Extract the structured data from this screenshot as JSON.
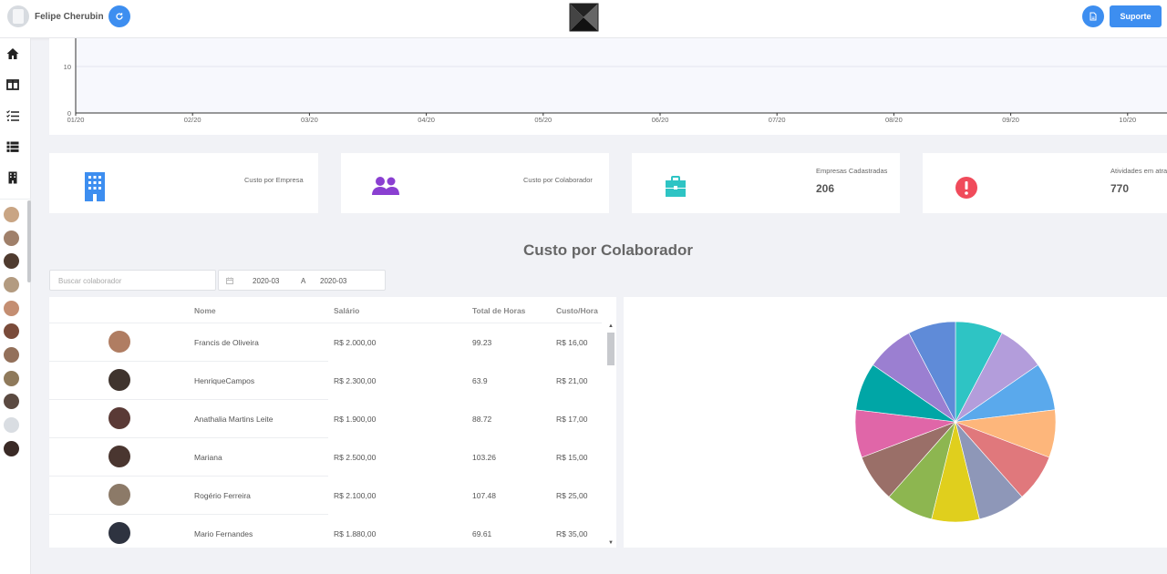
{
  "header": {
    "user_name": "Felipe Cherubin",
    "support_label": "Suporte"
  },
  "sidebar": {
    "nav": [
      "home-icon",
      "columns-icon",
      "task-list-icon",
      "list-icon",
      "building-icon"
    ],
    "avatars": [
      "#c9a584",
      "#a0806a",
      "#4f3b2f",
      "#b39b80",
      "#c48e72",
      "#7a4b3a",
      "#93705a",
      "#8f7a5b",
      "#5b4a41",
      "#d9dde2",
      "#3a2a26"
    ]
  },
  "chart": {
    "y_ticks": [
      "10",
      "0"
    ],
    "x_ticks": [
      "01/20",
      "02/20",
      "03/20",
      "04/20",
      "05/20",
      "06/20",
      "07/20",
      "08/20",
      "09/20",
      "10/20"
    ]
  },
  "stats": [
    {
      "label": "Custo por Empresa",
      "value": "",
      "icon": "building-icon",
      "color": "#3d8ef0"
    },
    {
      "label": "Custo por Colaborador",
      "value": "",
      "icon": "users-icon",
      "color": "#8a3fd1"
    },
    {
      "label": "Empresas Cadastradas",
      "value": "206",
      "icon": "briefcase-icon",
      "color": "#2ec4c4"
    },
    {
      "label": "Atividades em atra",
      "value": "770",
      "icon": "alert-icon",
      "color": "#f04b5b"
    }
  ],
  "section_title": "Custo por Colaborador",
  "search_placeholder": "Buscar colaborador",
  "date_filter": {
    "from": "2020-03",
    "separator": "A",
    "to": "2020-03"
  },
  "table": {
    "headers": [
      "Nome",
      "Salário",
      "Total de Horas",
      "Custo/Hora"
    ],
    "rows": [
      {
        "name": "Francis de Oliveira",
        "salary": "R$ 2.000,00",
        "hours": "99.23",
        "cost": "R$ 16,00",
        "avatar_color": "#b07d62"
      },
      {
        "name": "HenriqueCampos",
        "salary": "R$ 2.300,00",
        "hours": "63.9",
        "cost": "R$ 21,00",
        "avatar_color": "#3f342e"
      },
      {
        "name": "Anathalia Martins Leite",
        "salary": "R$ 1.900,00",
        "hours": "88.72",
        "cost": "R$ 17,00",
        "avatar_color": "#5a3a36"
      },
      {
        "name": "Mariana",
        "salary": "R$ 2.500,00",
        "hours": "103.26",
        "cost": "R$ 15,00",
        "avatar_color": "#4a3630"
      },
      {
        "name": "Rogério Ferreira",
        "salary": "R$ 2.100,00",
        "hours": "107.48",
        "cost": "R$ 25,00",
        "avatar_color": "#8c7a68"
      },
      {
        "name": "Mario Fernandes",
        "salary": "R$ 1.880,00",
        "hours": "69.61",
        "cost": "R$ 35,00",
        "avatar_color": "#2e3340"
      }
    ]
  },
  "pie": {
    "slices": [
      {
        "value": 1,
        "color": "#2ec4c4"
      },
      {
        "value": 1,
        "color": "#b39ddb"
      },
      {
        "value": 1,
        "color": "#5aa9ec"
      },
      {
        "value": 1,
        "color": "#fdb67b"
      },
      {
        "value": 1,
        "color": "#e0787c"
      },
      {
        "value": 1,
        "color": "#8e97b8"
      },
      {
        "value": 1,
        "color": "#e0cf1d"
      },
      {
        "value": 1,
        "color": "#8db650"
      },
      {
        "value": 1,
        "color": "#9a6f68"
      },
      {
        "value": 1,
        "color": "#e066a8"
      },
      {
        "value": 1,
        "color": "#00a6a6"
      },
      {
        "value": 1,
        "color": "#9b7fd1"
      },
      {
        "value": 1,
        "color": "#5f8bd8"
      }
    ]
  }
}
